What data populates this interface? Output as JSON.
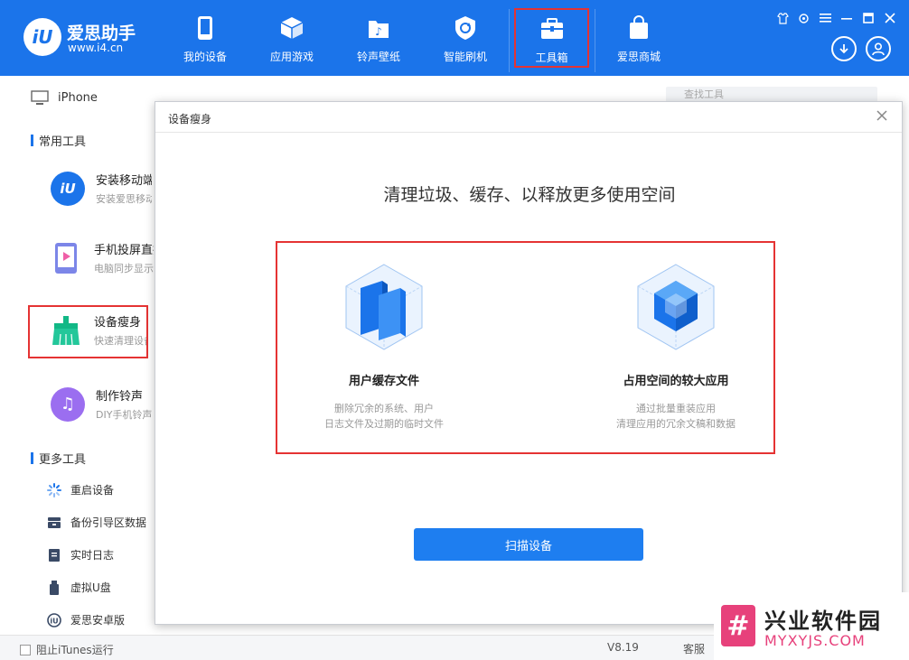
{
  "brand": {
    "name": "爱思助手",
    "url": "www.i4.cn",
    "logo_text": "iU"
  },
  "nav": [
    {
      "label": "我的设备",
      "icon": "phone-icon"
    },
    {
      "label": "应用游戏",
      "icon": "cube-icon"
    },
    {
      "label": "铃声壁纸",
      "icon": "music-folder-icon"
    },
    {
      "label": "智能刷机",
      "icon": "refresh-shield-icon"
    },
    {
      "label": "工具箱",
      "icon": "toolbox-icon",
      "active": true
    },
    {
      "label": "爱思商城",
      "icon": "shopping-bag-icon"
    }
  ],
  "sidebar": {
    "device": "iPhone",
    "common_title": "常用工具",
    "tools": [
      {
        "name": "安装移动端",
        "desc": "安装爱思移动端"
      },
      {
        "name": "手机投屏直播",
        "desc": "电脑同步显示手机"
      },
      {
        "name": "设备瘦身",
        "desc": "快速清理设备空间"
      },
      {
        "name": "制作铃声",
        "desc": "DIY手机铃声"
      }
    ],
    "more_title": "更多工具",
    "more": [
      {
        "label": "重启设备",
        "icon": "spinner-icon"
      },
      {
        "label": "备份引导区数据",
        "icon": "database-icon"
      },
      {
        "label": "实时日志",
        "icon": "log-icon"
      },
      {
        "label": "虚拟U盘",
        "icon": "usb-drive-icon"
      },
      {
        "label": "爱思安卓版",
        "icon": "i4-android-icon"
      }
    ]
  },
  "search": {
    "placeholder": "查找工具"
  },
  "modal": {
    "title": "设备瘦身",
    "heading": "清理垃圾、缓存、以释放更多使用空间",
    "options": [
      {
        "title": "用户缓存文件",
        "desc1": "删除冗余的系统、用户",
        "desc2": "日志文件及过期的临时文件"
      },
      {
        "title": "占用空间的较大应用",
        "desc1": "通过批量重装应用",
        "desc2": "清理应用的冗余文稿和数据"
      }
    ],
    "scan_button": "扫描设备"
  },
  "status": {
    "itunes": "阻止iTunes运行",
    "version": "V8.19",
    "service": "客服"
  },
  "watermark": {
    "title": "兴业软件园",
    "sub": "MYXYJS.COM"
  },
  "colors": {
    "primary": "#1b74ea",
    "highlight": "#e53333",
    "accent": "#e7417b"
  }
}
